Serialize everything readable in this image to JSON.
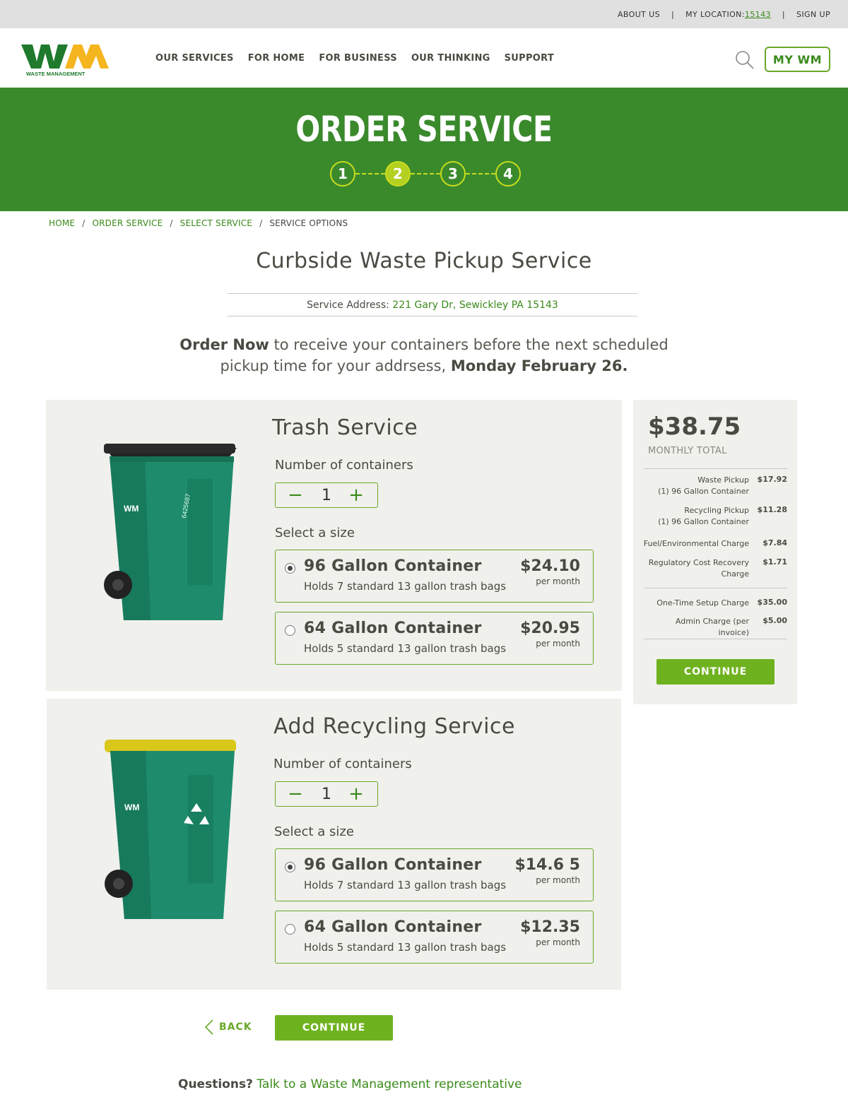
{
  "utility": {
    "about": "ABOUT US",
    "sep": "|",
    "location_label": "MY LOCATION:",
    "location_zip": "15143",
    "signup": "SIGN UP"
  },
  "header": {
    "logo_text": "WASTE MANAGEMENT",
    "nav": [
      "OUR SERVICES",
      "FOR HOME",
      "FOR BUSINESS",
      "OUR THINKING",
      "SUPPORT"
    ],
    "mywm": "MY WM"
  },
  "banner": {
    "title": "ORDER SERVICE",
    "steps": [
      "1",
      "2",
      "3",
      "4"
    ],
    "active_step": 2
  },
  "breadcrumb": {
    "items": [
      "HOME",
      "ORDER SERVICE",
      "SELECT SERVICE"
    ],
    "current": "SERVICE OPTIONS",
    "sep": "/"
  },
  "page": {
    "title": "Curbside Waste Pickup Service",
    "address_label": "Service Address:",
    "address": "221 Gary Dr, Sewickley PA 15143",
    "order_now": "Order Now",
    "order_text_1": "to receive your containers before the next scheduled",
    "order_text_2": "pickup time for your addrsess,",
    "order_date": "Monday February 26."
  },
  "trash": {
    "title": "Trash Service",
    "count_label": "Number of containers",
    "quantity": "1",
    "size_label": "Select a size",
    "cart_id": "6425687",
    "options": [
      {
        "name": "96 Gallon Container",
        "desc": "Holds 7 standard 13 gallon trash bags",
        "price": "$24.10",
        "unit": "per month",
        "selected": true
      },
      {
        "name": "64 Gallon Container",
        "desc": "Holds 5 standard 13 gallon trash bags",
        "price": "$20.95",
        "unit": "per month",
        "selected": false
      }
    ]
  },
  "recycling": {
    "title": "Add Recycling Service",
    "count_label": "Number of containers",
    "quantity": "1",
    "size_label": "Select a size",
    "options": [
      {
        "name": "96 Gallon Container",
        "desc": "Holds 7 standard 13 gallon trash bags",
        "price": "$14.6 5",
        "unit": "per month",
        "selected": true
      },
      {
        "name": "64 Gallon Container",
        "desc": "Holds 5 standard 13 gallon trash bags",
        "price": "$12.35",
        "unit": "per month",
        "selected": false
      }
    ]
  },
  "summary": {
    "total": "$38.75",
    "total_label": "MONTHLY TOTAL",
    "items": [
      {
        "label_1": "Waste Pickup",
        "label_2": "(1) 96 Gallon Container",
        "amount": "$17.92"
      },
      {
        "label_1": "Recycling Pickup",
        "label_2": "(1) 96 Gallon Container",
        "amount": "$11.28"
      },
      {
        "label_1": "Fuel/Environmental Charge",
        "label_2": "",
        "amount": "$7.84"
      },
      {
        "label_1": "Regulatory Cost Recovery",
        "label_2": "Charge",
        "amount": "$1.71"
      }
    ],
    "one_time": [
      {
        "label": "One-Time Setup Charge",
        "amount": "$35.00"
      },
      {
        "label": "Admin Charge (per invoice)",
        "amount": "$5.00"
      }
    ],
    "continue": "CONTINUE"
  },
  "footer_actions": {
    "back": "BACK",
    "continue": "CONTINUE",
    "questions": "Questions?",
    "rep_link": "Talk to a Waste Management representative"
  },
  "colors": {
    "brand_green": "#3a8a2c",
    "accent_lime": "#b4d021",
    "button_green": "#6fb21f",
    "logo_yellow": "#f5b51f",
    "cart_green": "#1d8a6a",
    "recycle_lid": "#d9c71a"
  }
}
